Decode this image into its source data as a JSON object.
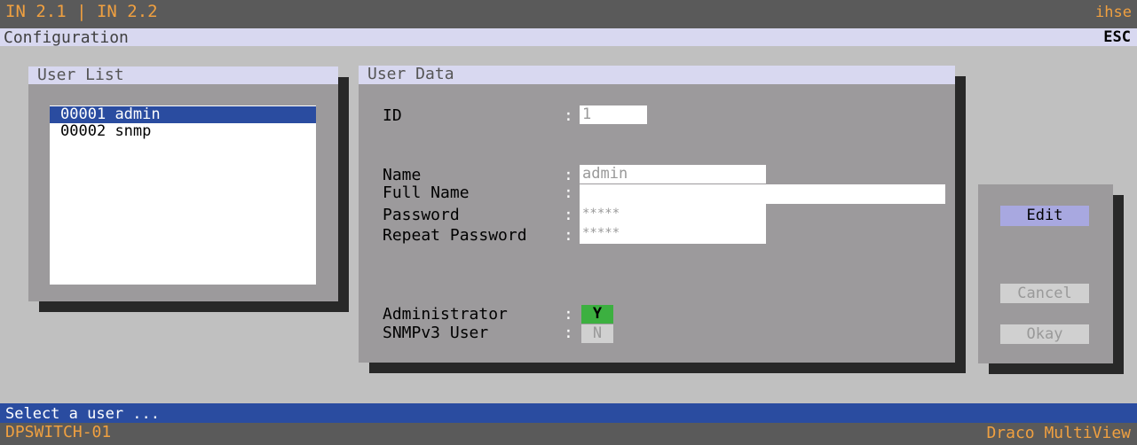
{
  "header": {
    "title": "IN 2.1 | IN 2.2",
    "brand": "ihse"
  },
  "subheader": {
    "title": "Configuration",
    "esc": "ESC"
  },
  "user_list": {
    "title": "User List",
    "items": [
      {
        "id": "00001",
        "name": "admin",
        "selected": true
      },
      {
        "id": "00002",
        "name": "snmp",
        "selected": false
      }
    ]
  },
  "user_data": {
    "title": "User Data",
    "id_label": "ID",
    "id_value": "1",
    "name_label": "Name",
    "name_value": "admin",
    "fullname_label": "Full Name",
    "fullname_value": "",
    "password_label": "Password",
    "password_value": "*****",
    "repeat_label": "Repeat Password",
    "repeat_value": "*****",
    "admin_label": "Administrator",
    "admin_value": "Y",
    "snmp_label": "SNMPv3 User",
    "snmp_value": "N",
    "colon": ":"
  },
  "actions": {
    "edit": "Edit",
    "cancel": "Cancel",
    "okay": "Okay"
  },
  "status": {
    "message": "Select a user ...",
    "device": "DPSWITCH-01",
    "product": "Draco MultiView"
  },
  "colors": {
    "accent_orange": "#f0a040",
    "selection_blue": "#2a4ca0",
    "admin_green": "#3cb040"
  }
}
